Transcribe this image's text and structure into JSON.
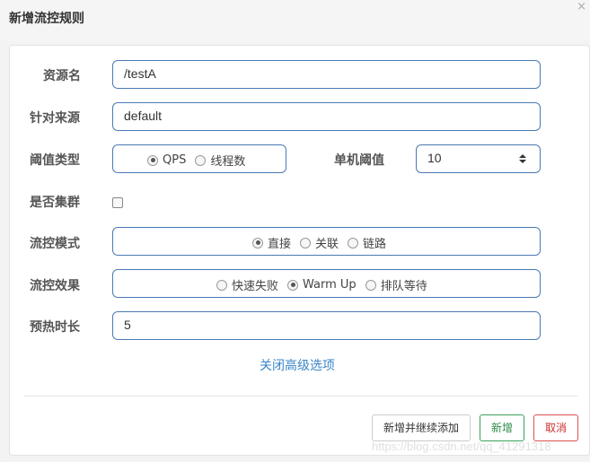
{
  "dialog": {
    "title": "新增流控规则",
    "close_glyph": "×"
  },
  "form": {
    "resource": {
      "label": "资源名",
      "value": "/testA"
    },
    "limit_app": {
      "label": "针对来源",
      "value": "default"
    },
    "threshold_type": {
      "label": "阈值类型",
      "options": [
        "QPS",
        "线程数"
      ],
      "selected": "QPS"
    },
    "single_threshold": {
      "label": "单机阈值",
      "value": "10"
    },
    "cluster": {
      "label": "是否集群",
      "checked": false
    },
    "strategy": {
      "label": "流控模式",
      "options": [
        "直接",
        "关联",
        "链路"
      ],
      "selected": "直接"
    },
    "control_behavior": {
      "label": "流控效果",
      "options": [
        "快速失败",
        "Warm Up",
        "排队等待"
      ],
      "selected": "Warm Up"
    },
    "warm_up_period": {
      "label": "预热时长",
      "value": "5"
    },
    "advanced_toggle": "关闭高级选项"
  },
  "footer": {
    "continue_label": "新增并继续添加",
    "add_label": "新增",
    "cancel_label": "取消"
  },
  "watermark": "https://blog.csdn.net/qq_41291318",
  "colors": {
    "input_border": "#4a7ab5",
    "link": "#3a86c8",
    "add_button": "#2e8b47",
    "cancel_button": "#c9302c"
  }
}
